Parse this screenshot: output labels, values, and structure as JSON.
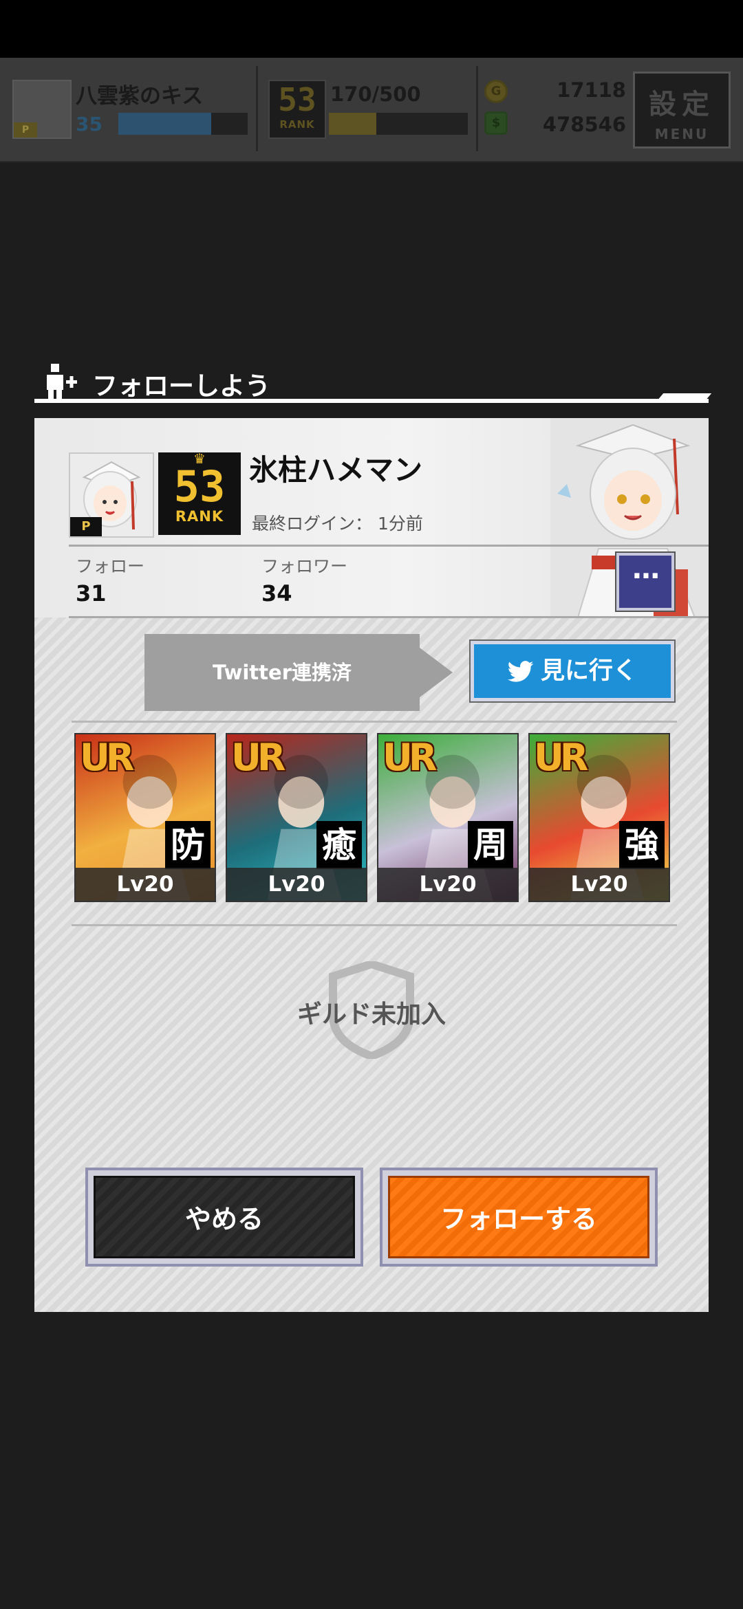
{
  "hud": {
    "player_name": "八雲紫のキス",
    "player_level": "35",
    "exp_progress": 0.72,
    "rank_number": "53",
    "rank_label": "RANK",
    "stamina": "170/500",
    "stamina_progress": 0.34,
    "coins": "17118",
    "gems": "478546",
    "settings_kanji": "設定",
    "settings_menu": "MENU"
  },
  "dialog": {
    "title": "フォローしよう",
    "profile": {
      "name": "氷柱ハメマン",
      "rank_number": "53",
      "rank_label": "RANK",
      "last_login": "最終ログイン： 1分前",
      "follow_label": "フォロー",
      "follow_count": "31",
      "follower_label": "フォロワー",
      "follower_count": "34",
      "more_label": "···"
    },
    "twitter": {
      "status": "Twitter連携済",
      "button_label": "見に行く"
    },
    "cards": [
      {
        "rarity": "UR",
        "role": "防",
        "level": "Lv20",
        "colors": [
          "#c93018",
          "#f1b040",
          "#e98c2a"
        ]
      },
      {
        "rarity": "UR",
        "role": "癒",
        "level": "Lv20",
        "colors": [
          "#b8261c",
          "#1e6d7a",
          "#2ac1c8"
        ]
      },
      {
        "rarity": "UR",
        "role": "周",
        "level": "Lv20",
        "colors": [
          "#3cae3a",
          "#c8c0d8",
          "#6a2a5a"
        ]
      },
      {
        "rarity": "UR",
        "role": "強",
        "level": "Lv20",
        "colors": [
          "#3cae3a",
          "#e84a30",
          "#f1e44a"
        ]
      }
    ],
    "guild_status": "ギルド未加入",
    "cancel_label": "やめる",
    "follow_button_label": "フォローする"
  }
}
